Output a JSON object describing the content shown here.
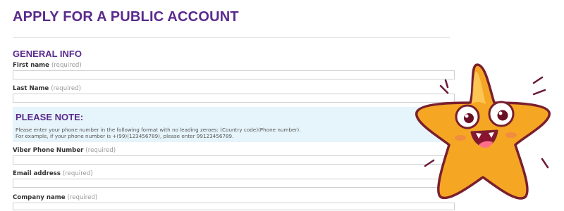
{
  "page": {
    "title": "APPLY FOR A PUBLIC ACCOUNT"
  },
  "general_info": {
    "heading": "GENERAL INFO",
    "fields": [
      {
        "label": "First name",
        "required": "(required)",
        "value": ""
      },
      {
        "label": "Last Name",
        "required": "(required)",
        "value": ""
      }
    ]
  },
  "note": {
    "title": "PLEASE NOTE:",
    "line1": "Please enter your phone number in the following format with no leading zeroes: (Country code)(Phone number).",
    "line2": "For example, if your phone number is +(99)(123456789), please enter 99123456789."
  },
  "contact_fields": [
    {
      "label": "Viber Phone Number",
      "required": "(required)",
      "value": ""
    },
    {
      "label": "Email address",
      "required": "(required)",
      "value": ""
    },
    {
      "label": "Company name",
      "required": "(required)",
      "value": ""
    }
  ],
  "colors": {
    "brand_purple": "#5a2a8c",
    "note_bg": "#e6f4fb",
    "star": "#f5a623"
  },
  "mascot": {
    "icon": "star-mascot-icon"
  }
}
